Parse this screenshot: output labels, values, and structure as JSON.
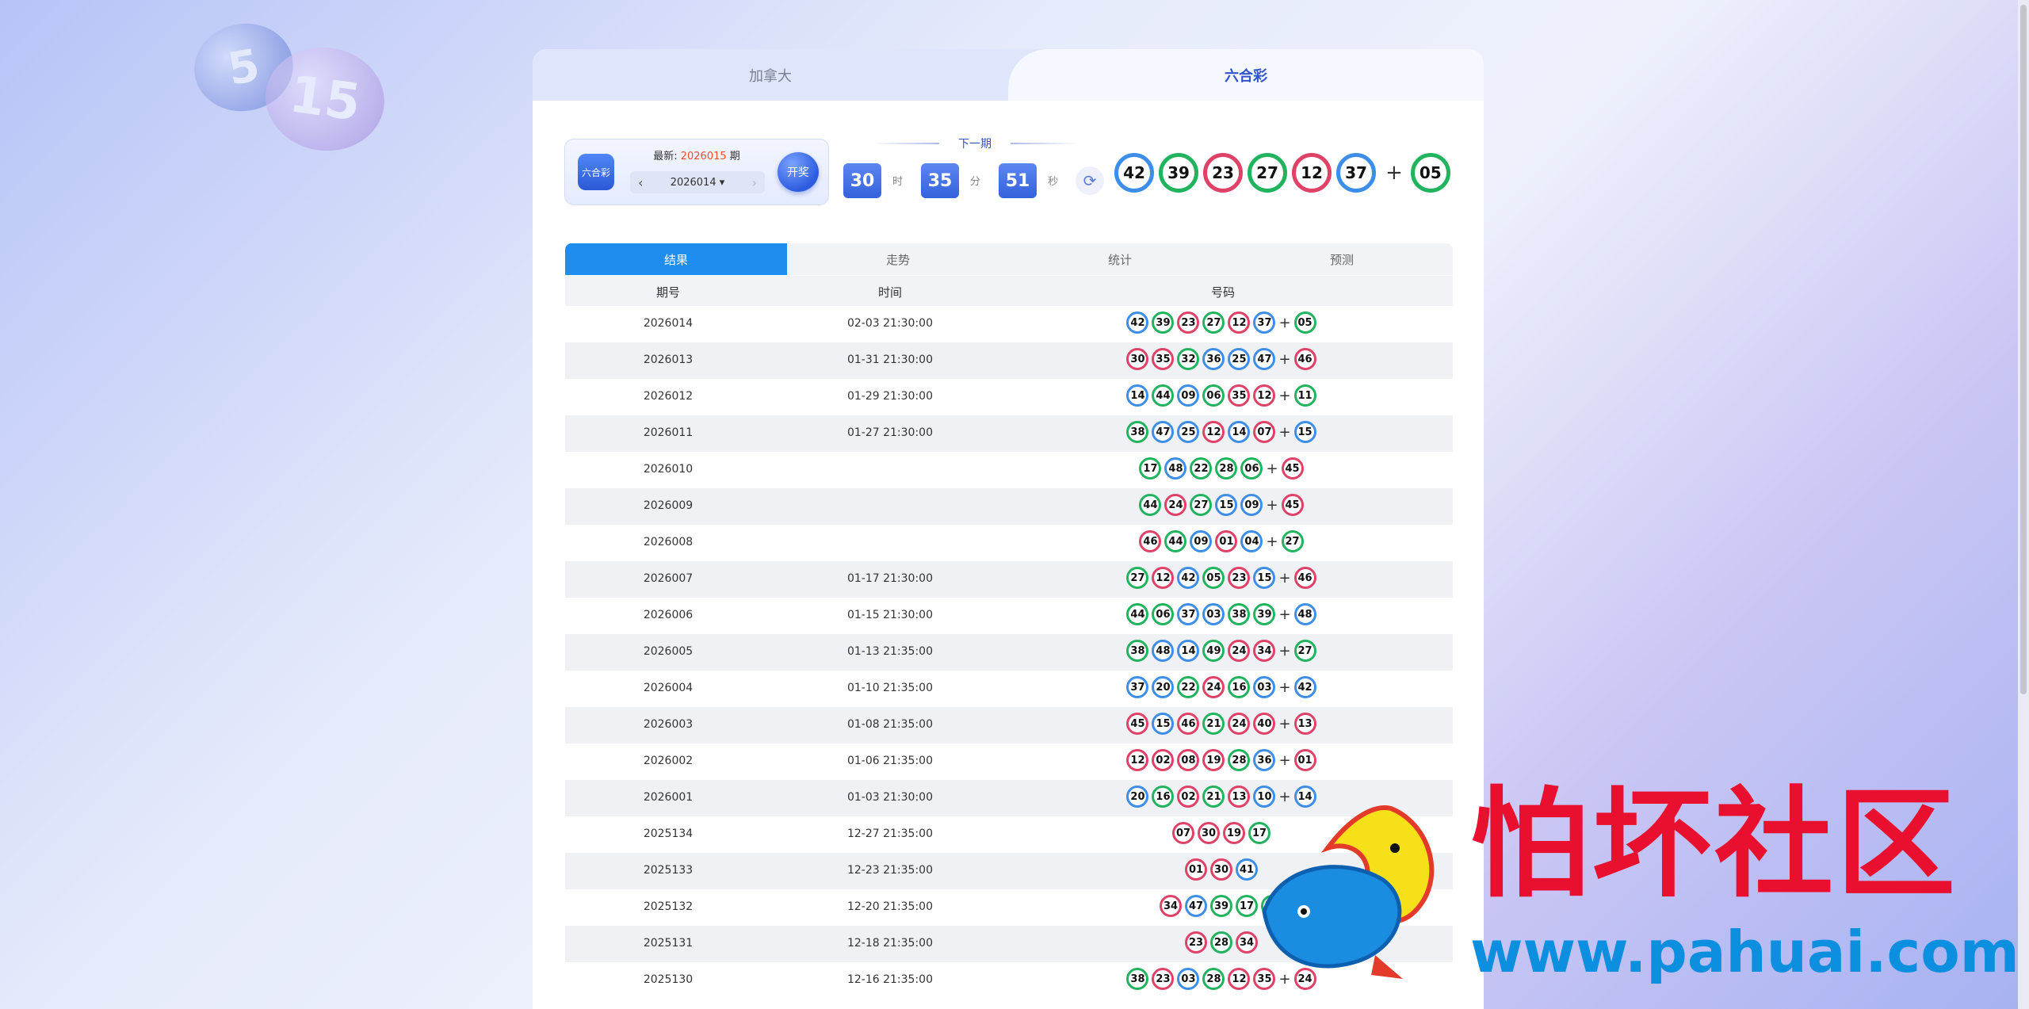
{
  "tabs": [
    {
      "label": "加拿大",
      "active": false
    },
    {
      "label": "六合彩",
      "active": true
    }
  ],
  "info": {
    "logo_text": "六合彩",
    "latest_prefix": "最新:",
    "latest_period": "2026015",
    "latest_suffix": "期",
    "selected_period": "2026014",
    "open_button": "开奖"
  },
  "next": {
    "label": "下一期",
    "hours": "30",
    "hours_unit": "时",
    "minutes": "35",
    "minutes_unit": "分",
    "seconds": "51",
    "seconds_unit": "秒"
  },
  "current_draw": {
    "numbers": [
      {
        "n": "42",
        "c": "blue"
      },
      {
        "n": "39",
        "c": "green"
      },
      {
        "n": "23",
        "c": "red"
      },
      {
        "n": "27",
        "c": "green"
      },
      {
        "n": "12",
        "c": "red"
      },
      {
        "n": "37",
        "c": "blue"
      }
    ],
    "special": {
      "n": "05",
      "c": "green"
    }
  },
  "sub_tabs": [
    {
      "label": "结果",
      "active": true
    },
    {
      "label": "走势",
      "active": false
    },
    {
      "label": "统计",
      "active": false
    },
    {
      "label": "预测",
      "active": false
    }
  ],
  "table": {
    "headers": [
      "期号",
      "时间",
      "号码"
    ],
    "rows": [
      {
        "period": "2026014",
        "time": "02-03 21:30:00",
        "nums": [
          [
            "42",
            "blue"
          ],
          [
            "39",
            "green"
          ],
          [
            "23",
            "red"
          ],
          [
            "27",
            "green"
          ],
          [
            "12",
            "red"
          ],
          [
            "37",
            "blue"
          ]
        ],
        "special": [
          "05",
          "green"
        ]
      },
      {
        "period": "2026013",
        "time": "01-31 21:30:00",
        "nums": [
          [
            "30",
            "red"
          ],
          [
            "35",
            "red"
          ],
          [
            "32",
            "green"
          ],
          [
            "36",
            "blue"
          ],
          [
            "25",
            "blue"
          ],
          [
            "47",
            "blue"
          ]
        ],
        "special": [
          "46",
          "red"
        ]
      },
      {
        "period": "2026012",
        "time": "01-29 21:30:00",
        "nums": [
          [
            "14",
            "blue"
          ],
          [
            "44",
            "green"
          ],
          [
            "09",
            "blue"
          ],
          [
            "06",
            "green"
          ],
          [
            "35",
            "red"
          ],
          [
            "12",
            "red"
          ]
        ],
        "special": [
          "11",
          "green"
        ]
      },
      {
        "period": "2026011",
        "time": "01-27 21:30:00",
        "nums": [
          [
            "38",
            "green"
          ],
          [
            "47",
            "blue"
          ],
          [
            "25",
            "blue"
          ],
          [
            "12",
            "red"
          ],
          [
            "14",
            "blue"
          ],
          [
            "07",
            "red"
          ]
        ],
        "special": [
          "15",
          "blue"
        ]
      },
      {
        "period": "2026010",
        "time": "",
        "nums": [
          [
            "17",
            "green"
          ],
          [
            "48",
            "blue"
          ],
          [
            "22",
            "green"
          ],
          [
            "28",
            "green"
          ],
          [
            "06",
            "green"
          ]
        ],
        "special": [
          "45",
          "red"
        ]
      },
      {
        "period": "2026009",
        "time": "",
        "nums": [
          [
            "44",
            "green"
          ],
          [
            "24",
            "red"
          ],
          [
            "27",
            "green"
          ],
          [
            "15",
            "blue"
          ],
          [
            "09",
            "blue"
          ]
        ],
        "special": [
          "45",
          "red"
        ]
      },
      {
        "period": "2026008",
        "time": "",
        "nums": [
          [
            "46",
            "red"
          ],
          [
            "44",
            "green"
          ],
          [
            "09",
            "blue"
          ],
          [
            "01",
            "red"
          ],
          [
            "04",
            "blue"
          ]
        ],
        "special": [
          "27",
          "green"
        ]
      },
      {
        "period": "2026007",
        "time": "01-17 21:30:00",
        "nums": [
          [
            "27",
            "green"
          ],
          [
            "12",
            "red"
          ],
          [
            "42",
            "blue"
          ],
          [
            "05",
            "green"
          ],
          [
            "23",
            "red"
          ],
          [
            "15",
            "blue"
          ]
        ],
        "special": [
          "46",
          "red"
        ]
      },
      {
        "period": "2026006",
        "time": "01-15 21:30:00",
        "nums": [
          [
            "44",
            "green"
          ],
          [
            "06",
            "green"
          ],
          [
            "37",
            "blue"
          ],
          [
            "03",
            "blue"
          ],
          [
            "38",
            "green"
          ],
          [
            "39",
            "green"
          ]
        ],
        "special": [
          "48",
          "blue"
        ]
      },
      {
        "period": "2026005",
        "time": "01-13 21:35:00",
        "nums": [
          [
            "38",
            "green"
          ],
          [
            "48",
            "blue"
          ],
          [
            "14",
            "blue"
          ],
          [
            "49",
            "green"
          ],
          [
            "24",
            "red"
          ],
          [
            "34",
            "red"
          ]
        ],
        "special": [
          "27",
          "green"
        ]
      },
      {
        "period": "2026004",
        "time": "01-10 21:35:00",
        "nums": [
          [
            "37",
            "blue"
          ],
          [
            "20",
            "blue"
          ],
          [
            "22",
            "green"
          ],
          [
            "24",
            "red"
          ],
          [
            "16",
            "green"
          ],
          [
            "03",
            "blue"
          ]
        ],
        "special": [
          "42",
          "blue"
        ]
      },
      {
        "period": "2026003",
        "time": "01-08 21:35:00",
        "nums": [
          [
            "45",
            "red"
          ],
          [
            "15",
            "blue"
          ],
          [
            "46",
            "red"
          ],
          [
            "21",
            "green"
          ],
          [
            "24",
            "red"
          ],
          [
            "40",
            "red"
          ]
        ],
        "special": [
          "13",
          "red"
        ]
      },
      {
        "period": "2026002",
        "time": "01-06 21:35:00",
        "nums": [
          [
            "12",
            "red"
          ],
          [
            "02",
            "red"
          ],
          [
            "08",
            "red"
          ],
          [
            "19",
            "red"
          ],
          [
            "28",
            "green"
          ],
          [
            "36",
            "blue"
          ]
        ],
        "special": [
          "01",
          "red"
        ]
      },
      {
        "period": "2026001",
        "time": "01-03 21:30:00",
        "nums": [
          [
            "20",
            "blue"
          ],
          [
            "16",
            "green"
          ],
          [
            "02",
            "red"
          ],
          [
            "21",
            "green"
          ],
          [
            "13",
            "red"
          ],
          [
            "10",
            "blue"
          ]
        ],
        "special": [
          "14",
          "blue"
        ]
      },
      {
        "period": "2025134",
        "time": "12-27 21:35:00",
        "nums": [
          [
            "07",
            "red"
          ],
          [
            "30",
            "red"
          ],
          [
            "19",
            "red"
          ],
          [
            "17",
            "green"
          ]
        ],
        "special": []
      },
      {
        "period": "2025133",
        "time": "12-23 21:35:00",
        "nums": [
          [
            "01",
            "red"
          ],
          [
            "30",
            "red"
          ],
          [
            "41",
            "blue"
          ]
        ],
        "special": []
      },
      {
        "period": "2025132",
        "time": "12-20 21:35:00",
        "nums": [
          [
            "34",
            "red"
          ],
          [
            "47",
            "blue"
          ],
          [
            "39",
            "green"
          ],
          [
            "17",
            "green"
          ],
          [
            "27",
            "green"
          ]
        ],
        "special": []
      },
      {
        "period": "2025131",
        "time": "12-18 21:35:00",
        "nums": [
          [
            "23",
            "red"
          ],
          [
            "28",
            "green"
          ],
          [
            "34",
            "red"
          ]
        ],
        "special": []
      },
      {
        "period": "2025130",
        "time": "12-16 21:35:00",
        "nums": [
          [
            "38",
            "green"
          ],
          [
            "23",
            "red"
          ],
          [
            "03",
            "blue"
          ],
          [
            "28",
            "green"
          ],
          [
            "12",
            "red"
          ],
          [
            "35",
            "red"
          ]
        ],
        "special": [
          "24",
          "red"
        ]
      }
    ]
  },
  "watermark": {
    "title": "怕坏社区",
    "url": "www.pahuai.com"
  },
  "background": {
    "ball_1": "5",
    "ball_2": "15"
  },
  "colors": {
    "red": "#e04167",
    "blue": "#3d8ee8",
    "green": "#22b35e",
    "accent": "#1f8cf0"
  }
}
